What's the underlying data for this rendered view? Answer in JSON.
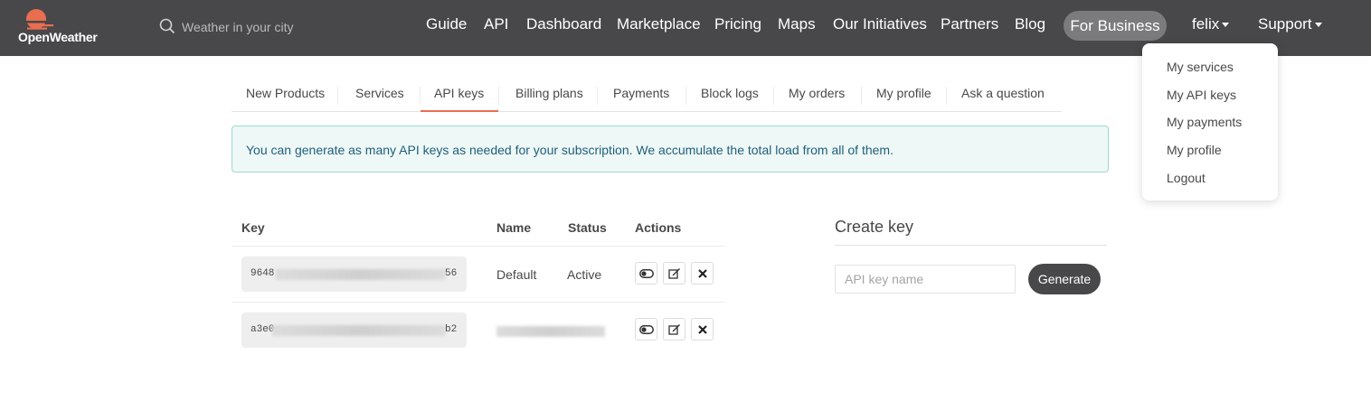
{
  "header": {
    "brand": "OpenWeather",
    "search": {
      "placeholder": "Weather in your city",
      "value": ""
    },
    "nav": [
      "Guide",
      "API",
      "Dashboard",
      "Marketplace",
      "Pricing",
      "Maps",
      "Our Initiatives",
      "Partners",
      "Blog"
    ],
    "business": "For Business",
    "user": "felix",
    "support": "Support",
    "colors": {
      "bar": "#48484a",
      "logo": "#e96e50",
      "business_pill": "#7b7b7d"
    }
  },
  "user_menu": {
    "items": [
      "My services",
      "My API keys",
      "My payments",
      "My profile",
      "Logout"
    ]
  },
  "tabs": {
    "items": [
      "New Products",
      "Services",
      "API keys",
      "Billing plans",
      "Payments",
      "Block logs",
      "My orders",
      "My profile",
      "Ask a question"
    ],
    "active": "API keys",
    "active_color": "#e96e50"
  },
  "alert": {
    "text": "You can generate as many API keys as needed for your subscription. We accumulate the total load from all of them."
  },
  "keys_table": {
    "headers": {
      "key": "Key",
      "name": "Name",
      "status": "Status",
      "actions": "Actions"
    },
    "rows": [
      {
        "key_start": "9648",
        "key_end": "56",
        "name": "Default",
        "status": "Active"
      },
      {
        "key_start": "a3e0",
        "key_end": "b2",
        "name": "",
        "status": ""
      }
    ],
    "action_icons": [
      "toggle-icon",
      "edit-icon",
      "delete-icon"
    ]
  },
  "create_key": {
    "title": "Create key",
    "placeholder": "API key name",
    "button": "Generate"
  }
}
